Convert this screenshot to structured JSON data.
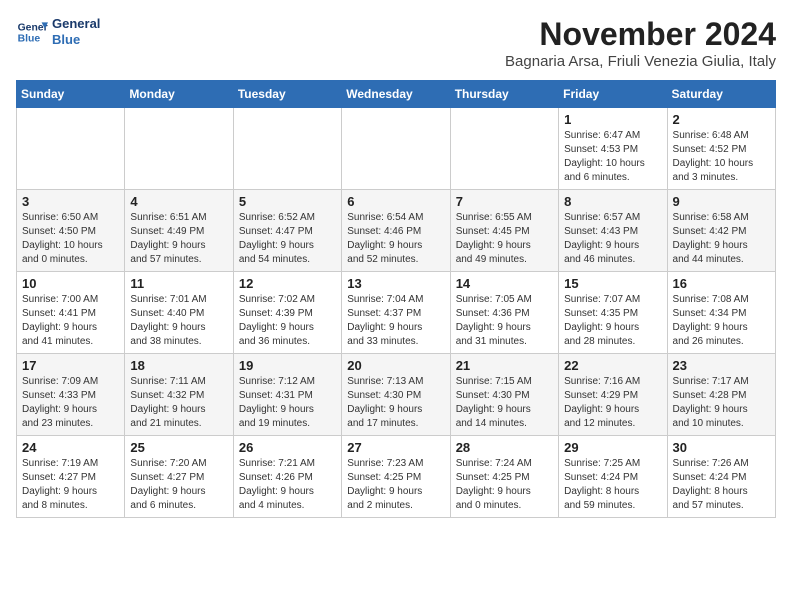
{
  "logo": {
    "line1": "General",
    "line2": "Blue"
  },
  "title": "November 2024",
  "subtitle": "Bagnaria Arsa, Friuli Venezia Giulia, Italy",
  "days_of_week": [
    "Sunday",
    "Monday",
    "Tuesday",
    "Wednesday",
    "Thursday",
    "Friday",
    "Saturday"
  ],
  "weeks": [
    [
      {
        "day": "",
        "info": ""
      },
      {
        "day": "",
        "info": ""
      },
      {
        "day": "",
        "info": ""
      },
      {
        "day": "",
        "info": ""
      },
      {
        "day": "",
        "info": ""
      },
      {
        "day": "1",
        "info": "Sunrise: 6:47 AM\nSunset: 4:53 PM\nDaylight: 10 hours\nand 6 minutes."
      },
      {
        "day": "2",
        "info": "Sunrise: 6:48 AM\nSunset: 4:52 PM\nDaylight: 10 hours\nand 3 minutes."
      }
    ],
    [
      {
        "day": "3",
        "info": "Sunrise: 6:50 AM\nSunset: 4:50 PM\nDaylight: 10 hours\nand 0 minutes."
      },
      {
        "day": "4",
        "info": "Sunrise: 6:51 AM\nSunset: 4:49 PM\nDaylight: 9 hours\nand 57 minutes."
      },
      {
        "day": "5",
        "info": "Sunrise: 6:52 AM\nSunset: 4:47 PM\nDaylight: 9 hours\nand 54 minutes."
      },
      {
        "day": "6",
        "info": "Sunrise: 6:54 AM\nSunset: 4:46 PM\nDaylight: 9 hours\nand 52 minutes."
      },
      {
        "day": "7",
        "info": "Sunrise: 6:55 AM\nSunset: 4:45 PM\nDaylight: 9 hours\nand 49 minutes."
      },
      {
        "day": "8",
        "info": "Sunrise: 6:57 AM\nSunset: 4:43 PM\nDaylight: 9 hours\nand 46 minutes."
      },
      {
        "day": "9",
        "info": "Sunrise: 6:58 AM\nSunset: 4:42 PM\nDaylight: 9 hours\nand 44 minutes."
      }
    ],
    [
      {
        "day": "10",
        "info": "Sunrise: 7:00 AM\nSunset: 4:41 PM\nDaylight: 9 hours\nand 41 minutes."
      },
      {
        "day": "11",
        "info": "Sunrise: 7:01 AM\nSunset: 4:40 PM\nDaylight: 9 hours\nand 38 minutes."
      },
      {
        "day": "12",
        "info": "Sunrise: 7:02 AM\nSunset: 4:39 PM\nDaylight: 9 hours\nand 36 minutes."
      },
      {
        "day": "13",
        "info": "Sunrise: 7:04 AM\nSunset: 4:37 PM\nDaylight: 9 hours\nand 33 minutes."
      },
      {
        "day": "14",
        "info": "Sunrise: 7:05 AM\nSunset: 4:36 PM\nDaylight: 9 hours\nand 31 minutes."
      },
      {
        "day": "15",
        "info": "Sunrise: 7:07 AM\nSunset: 4:35 PM\nDaylight: 9 hours\nand 28 minutes."
      },
      {
        "day": "16",
        "info": "Sunrise: 7:08 AM\nSunset: 4:34 PM\nDaylight: 9 hours\nand 26 minutes."
      }
    ],
    [
      {
        "day": "17",
        "info": "Sunrise: 7:09 AM\nSunset: 4:33 PM\nDaylight: 9 hours\nand 23 minutes."
      },
      {
        "day": "18",
        "info": "Sunrise: 7:11 AM\nSunset: 4:32 PM\nDaylight: 9 hours\nand 21 minutes."
      },
      {
        "day": "19",
        "info": "Sunrise: 7:12 AM\nSunset: 4:31 PM\nDaylight: 9 hours\nand 19 minutes."
      },
      {
        "day": "20",
        "info": "Sunrise: 7:13 AM\nSunset: 4:30 PM\nDaylight: 9 hours\nand 17 minutes."
      },
      {
        "day": "21",
        "info": "Sunrise: 7:15 AM\nSunset: 4:30 PM\nDaylight: 9 hours\nand 14 minutes."
      },
      {
        "day": "22",
        "info": "Sunrise: 7:16 AM\nSunset: 4:29 PM\nDaylight: 9 hours\nand 12 minutes."
      },
      {
        "day": "23",
        "info": "Sunrise: 7:17 AM\nSunset: 4:28 PM\nDaylight: 9 hours\nand 10 minutes."
      }
    ],
    [
      {
        "day": "24",
        "info": "Sunrise: 7:19 AM\nSunset: 4:27 PM\nDaylight: 9 hours\nand 8 minutes."
      },
      {
        "day": "25",
        "info": "Sunrise: 7:20 AM\nSunset: 4:27 PM\nDaylight: 9 hours\nand 6 minutes."
      },
      {
        "day": "26",
        "info": "Sunrise: 7:21 AM\nSunset: 4:26 PM\nDaylight: 9 hours\nand 4 minutes."
      },
      {
        "day": "27",
        "info": "Sunrise: 7:23 AM\nSunset: 4:25 PM\nDaylight: 9 hours\nand 2 minutes."
      },
      {
        "day": "28",
        "info": "Sunrise: 7:24 AM\nSunset: 4:25 PM\nDaylight: 9 hours\nand 0 minutes."
      },
      {
        "day": "29",
        "info": "Sunrise: 7:25 AM\nSunset: 4:24 PM\nDaylight: 8 hours\nand 59 minutes."
      },
      {
        "day": "30",
        "info": "Sunrise: 7:26 AM\nSunset: 4:24 PM\nDaylight: 8 hours\nand 57 minutes."
      }
    ]
  ]
}
